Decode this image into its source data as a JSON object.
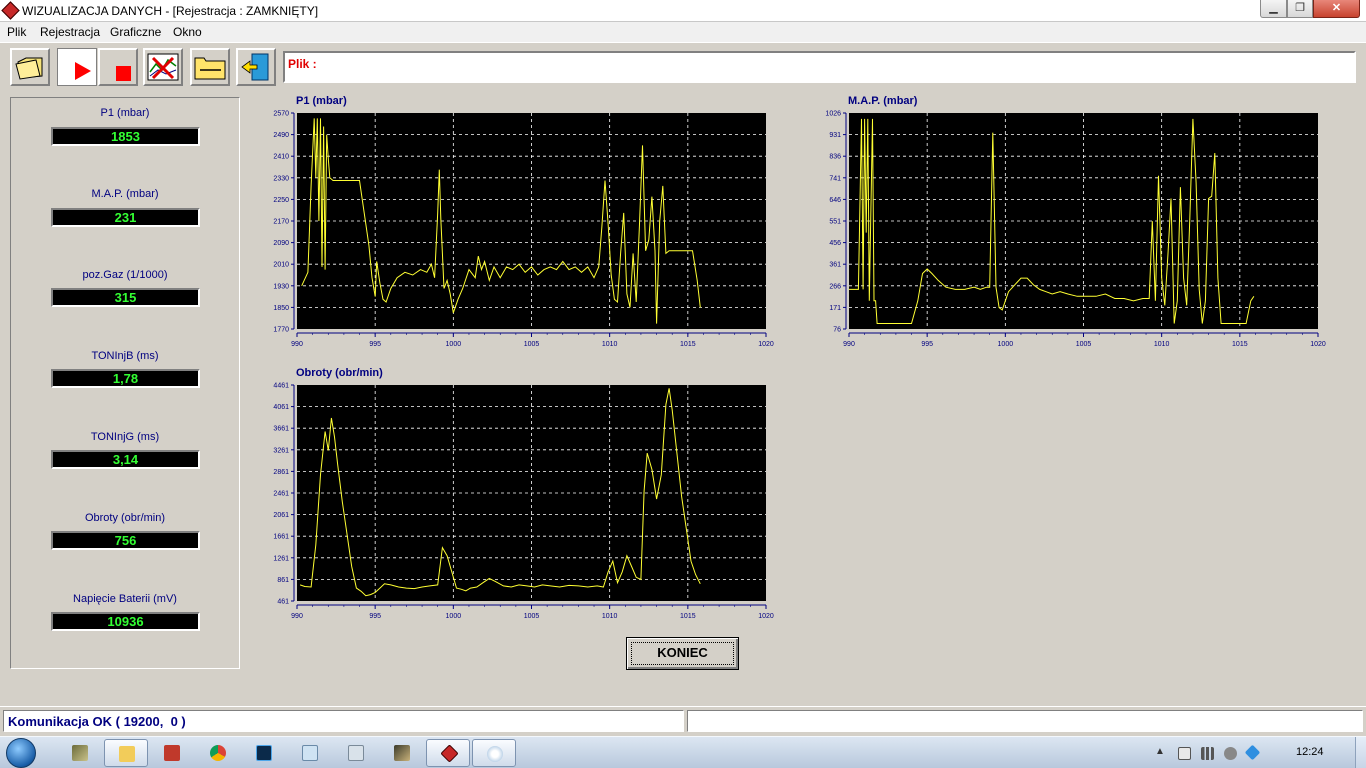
{
  "window": {
    "title": "WIZUALIZACJA DANYCH - [Rejestracja : ZAMKNIĘTY]",
    "min_glyph": "▁",
    "max_glyph": "❐",
    "close_glyph": "✕"
  },
  "menu": [
    "Plik",
    "Rejestracja",
    "Graficzne",
    "Okno"
  ],
  "toolbar": {
    "buttons": [
      "open-folder-icon",
      "play-icon",
      "stop-icon",
      "delete-chart-icon",
      "folder-icon",
      "exit-door-icon"
    ],
    "file_label": "Plik :"
  },
  "readouts": [
    {
      "label": "P1 (mbar)",
      "value": "1853"
    },
    {
      "label": "M.A.P. (mbar)",
      "value": "231"
    },
    {
      "label": "poz.Gaz (1/1000)",
      "value": "315"
    },
    {
      "label": "TONInjB (ms)",
      "value": "1,78"
    },
    {
      "label": "TONInjG (ms)",
      "value": "3,14"
    },
    {
      "label": "Obroty (obr/min)",
      "value": "756"
    },
    {
      "label": "Napięcie Baterii (mV)",
      "value": "10936"
    }
  ],
  "colors": {
    "plot_bg": "#000000",
    "trace": "#ffff33",
    "grid": "#ffffff",
    "readout_text": "#33ff33",
    "axis_text": "#000080",
    "file_label": "#e00000"
  },
  "chart_data": [
    {
      "type": "line",
      "title": "P1 (mbar)",
      "xlim": [
        990,
        1020
      ],
      "xticks": [
        "990",
        "995",
        "1000",
        "1005",
        "1010",
        "1015",
        "1020"
      ],
      "ylim": [
        1770,
        2570
      ],
      "yticks": [
        "2570",
        "2490",
        "2410",
        "2330",
        "2250",
        "2170",
        "2090",
        "2010",
        "1930",
        "1850",
        "1770"
      ],
      "grid": true,
      "series": [
        {
          "x": [
            990.3,
            990.7,
            990.9,
            991.1,
            991.2,
            991.3,
            991.4,
            991.5,
            991.6,
            991.7,
            991.8,
            991.9,
            992.0,
            992.1,
            992.3,
            992.6,
            993.0,
            993.5,
            994.0,
            994.3,
            994.6,
            994.8,
            995.0,
            995.1,
            995.3,
            995.5,
            995.7,
            996.0,
            996.4,
            996.9,
            997.4,
            997.9,
            998.3,
            998.6,
            998.8,
            999.0,
            999.1,
            999.2,
            999.4,
            999.6,
            999.8,
            1000.0,
            1000.3,
            1000.6,
            1001.0,
            1001.4,
            1001.6,
            1001.8,
            1002.0,
            1002.3,
            1002.6,
            1003.0,
            1003.4,
            1003.8,
            1004.2,
            1004.6,
            1005.0,
            1005.4,
            1005.8,
            1006.2,
            1006.6,
            1007.0,
            1007.4,
            1007.8,
            1008.2,
            1008.6,
            1009.0,
            1009.3,
            1009.5,
            1009.7,
            1009.9,
            1010.1,
            1010.3,
            1010.5,
            1010.7,
            1010.9,
            1011.1,
            1011.3,
            1011.5,
            1011.7,
            1011.9,
            1012.1,
            1012.3,
            1012.5,
            1012.7,
            1012.9,
            1013.0,
            1013.2,
            1013.4,
            1013.6,
            1013.8,
            1014.0,
            1014.5,
            1015.0,
            1015.3,
            1015.6,
            1015.8
          ],
          "y": [
            1930,
            1980,
            2300,
            2550,
            2330,
            2550,
            2170,
            2550,
            2000,
            2520,
            1990,
            2490,
            2400,
            2330,
            2320,
            2320,
            2320,
            2320,
            2320,
            2200,
            2080,
            1960,
            1890,
            2020,
            1940,
            1880,
            1870,
            1920,
            1960,
            1980,
            1970,
            1990,
            1980,
            2010,
            1960,
            2200,
            2360,
            2180,
            1920,
            1950,
            1900,
            1830,
            1880,
            1920,
            1990,
            1960,
            2040,
            1990,
            2020,
            1950,
            2000,
            1960,
            2000,
            1990,
            2010,
            1980,
            2000,
            1970,
            1990,
            2000,
            1990,
            2020,
            1990,
            2000,
            1980,
            2000,
            1960,
            2000,
            2150,
            2320,
            2160,
            1970,
            1880,
            1870,
            2050,
            2200,
            1900,
            1850,
            2050,
            1870,
            2150,
            2450,
            2060,
            2100,
            2260,
            2060,
            1790,
            2170,
            2300,
            2050,
            2060,
            2060,
            2060,
            2060,
            2060,
            1950,
            1850
          ]
        }
      ]
    },
    {
      "type": "line",
      "title": "M.A.P. (mbar)",
      "xlim": [
        990,
        1020
      ],
      "xticks": [
        "990",
        "995",
        "1000",
        "1005",
        "1010",
        "1015",
        "1020"
      ],
      "ylim": [
        76,
        1026
      ],
      "yticks": [
        "1026",
        "931",
        "836",
        "741",
        "646",
        "551",
        "456",
        "361",
        "266",
        "171",
        "76"
      ],
      "grid": true,
      "series": [
        {
          "x": [
            990.0,
            990.4,
            990.6,
            990.8,
            990.9,
            991.0,
            991.1,
            991.2,
            991.3,
            991.5,
            991.6,
            991.7,
            991.8,
            992.0,
            992.2,
            992.4,
            993.0,
            994.0,
            994.4,
            994.7,
            995.0,
            995.3,
            995.7,
            996.2,
            996.8,
            997.4,
            998.0,
            998.4,
            998.8,
            999.0,
            999.2,
            999.4,
            999.6,
            999.8,
            1000.2,
            1000.6,
            1001.0,
            1001.4,
            1001.8,
            1002.2,
            1002.6,
            1003.0,
            1003.5,
            1004.0,
            1004.6,
            1005.2,
            1005.8,
            1006.4,
            1007.0,
            1007.6,
            1008.2,
            1008.8,
            1009.2,
            1009.4,
            1009.6,
            1009.8,
            1010.0,
            1010.2,
            1010.4,
            1010.6,
            1010.8,
            1011.0,
            1011.2,
            1011.4,
            1011.6,
            1011.8,
            1012.0,
            1012.2,
            1012.4,
            1012.6,
            1012.8,
            1013.0,
            1013.2,
            1013.4,
            1013.6,
            1013.8,
            1014.2,
            1015.0,
            1015.4,
            1015.7,
            1015.9
          ],
          "y": [
            250,
            250,
            250,
            1000,
            250,
            1000,
            500,
            1000,
            200,
            1000,
            200,
            200,
            100,
            100,
            100,
            100,
            100,
            100,
            200,
            320,
            340,
            320,
            290,
            260,
            250,
            250,
            260,
            250,
            260,
            260,
            940,
            260,
            170,
            160,
            240,
            270,
            300,
            300,
            270,
            250,
            240,
            230,
            240,
            230,
            220,
            220,
            220,
            230,
            210,
            210,
            200,
            210,
            210,
            550,
            200,
            750,
            300,
            180,
            400,
            650,
            100,
            200,
            700,
            300,
            180,
            560,
            1000,
            720,
            250,
            100,
            200,
            650,
            660,
            850,
            300,
            100,
            100,
            100,
            100,
            200,
            220
          ]
        }
      ]
    },
    {
      "type": "line",
      "title": "Obroty (obr/min)",
      "xlim": [
        990,
        1020
      ],
      "xticks": [
        "990",
        "995",
        "1000",
        "1005",
        "1010",
        "1015",
        "1020"
      ],
      "ylim": [
        461,
        4461
      ],
      "yticks": [
        "4461",
        "4061",
        "3661",
        "3261",
        "2861",
        "2461",
        "2061",
        "1661",
        "1261",
        "861",
        "461"
      ],
      "grid": true,
      "series": [
        {
          "x": [
            990.2,
            990.5,
            990.9,
            991.2,
            991.5,
            991.8,
            992.0,
            992.2,
            992.4,
            992.6,
            992.9,
            993.2,
            993.5,
            993.8,
            994.1,
            994.4,
            994.7,
            995.0,
            995.3,
            995.6,
            996.0,
            996.5,
            997.0,
            997.5,
            998.0,
            998.5,
            999.0,
            999.3,
            999.6,
            999.9,
            1000.2,
            1000.5,
            1000.8,
            1001.1,
            1001.5,
            1001.9,
            1002.3,
            1002.7,
            1003.2,
            1003.7,
            1004.2,
            1004.7,
            1005.2,
            1005.7,
            1006.2,
            1006.8,
            1007.4,
            1008.0,
            1008.6,
            1009.2,
            1009.6,
            1009.9,
            1010.2,
            1010.5,
            1010.8,
            1011.1,
            1011.4,
            1011.7,
            1012.0,
            1012.2,
            1012.4,
            1012.7,
            1013.0,
            1013.3,
            1013.6,
            1013.8,
            1014.0,
            1014.3,
            1014.6,
            1014.9,
            1015.2,
            1015.5,
            1015.8
          ],
          "y": [
            760,
            730,
            720,
            1500,
            2800,
            3600,
            3250,
            3850,
            3500,
            3000,
            2300,
            1700,
            1100,
            700,
            640,
            560,
            580,
            620,
            700,
            780,
            760,
            720,
            700,
            690,
            720,
            740,
            760,
            1450,
            1300,
            1000,
            700,
            680,
            650,
            700,
            720,
            800,
            880,
            820,
            740,
            720,
            760,
            740,
            720,
            760,
            740,
            720,
            750,
            740,
            720,
            740,
            720,
            1000,
            1200,
            800,
            1000,
            1300,
            1100,
            900,
            860,
            2500,
            3200,
            2900,
            2350,
            2800,
            4100,
            4400,
            4000,
            3200,
            2400,
            1800,
            1200,
            950,
            780
          ]
        }
      ]
    }
  ],
  "koniec_button": {
    "label": "KONIEC"
  },
  "status": {
    "left": "Komunikacja OK ( 19200,  0 )",
    "right": ""
  },
  "taskbar": {
    "apps": [
      "app1-icon",
      "explorer-icon",
      "acrobat-icon",
      "chrome-icon",
      "photoshop-icon",
      "notepad-icon",
      "calculator-icon",
      "app2-icon",
      "wizualizacja-icon",
      "paint-icon"
    ],
    "clock": "12:24"
  }
}
